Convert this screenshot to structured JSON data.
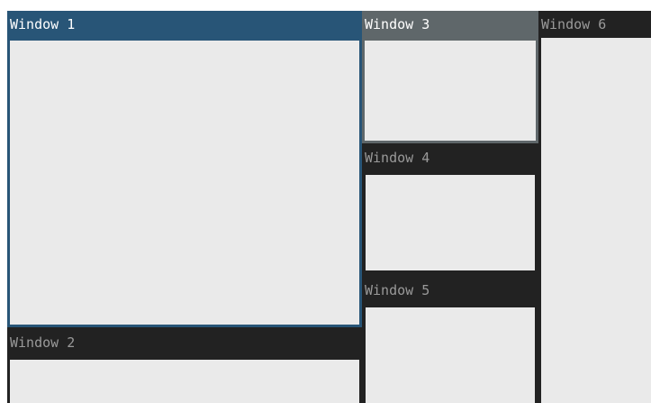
{
  "windows": {
    "w1": {
      "title": "Window 1"
    },
    "w2": {
      "title": "Window 2"
    },
    "w3": {
      "title": "Window 3"
    },
    "w4": {
      "title": "Window 4"
    },
    "w5": {
      "title": "Window 5"
    },
    "w6": {
      "title": "Window 6"
    }
  },
  "colors": {
    "focused": "#285577",
    "focused_inactive": "#5f676a",
    "unfocused": "#222222",
    "client_background": "#eaeaea"
  }
}
